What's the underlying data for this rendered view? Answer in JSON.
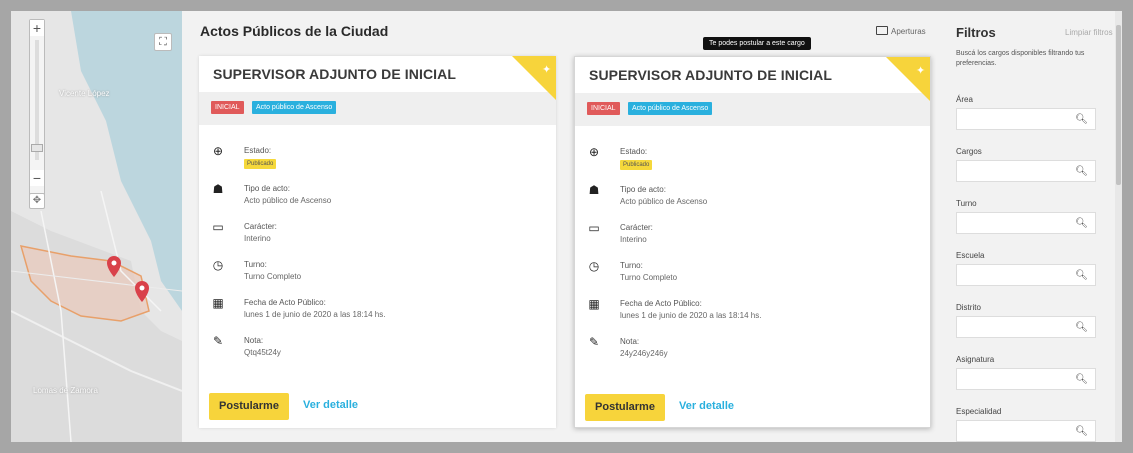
{
  "header": {
    "title": "Actos Públicos de la Ciudad",
    "aperturas": "Aperturas",
    "tooltip": "Te podes postular a este cargo"
  },
  "map": {
    "zoom_in": "+",
    "zoom_out": "−",
    "fullscreen": "⛶",
    "pan": "✥",
    "labels": [
      "Vicente López",
      "Lomas de Zamora"
    ]
  },
  "cards": [
    {
      "title": "SUPERVISOR ADJUNTO DE INICIAL",
      "badge_level": "INICIAL",
      "badge_type": "Acto público de Ascenso",
      "estado_label": "Estado:",
      "estado_value": "Publicado",
      "tipo_label": "Tipo de acto:",
      "tipo_value": "Acto público de Ascenso",
      "caracter_label": "Carácter:",
      "caracter_value": "Interino",
      "turno_label": "Turno:",
      "turno_value": "Turno Completo",
      "fecha_label": "Fecha de Acto Público:",
      "fecha_value": "lunes 1 de junio de 2020 a las 18:14 hs.",
      "nota_label": "Nota:",
      "nota_value": "Qtq45t24y",
      "postular": "Postularme",
      "detalle": "Ver detalle"
    },
    {
      "title": "SUPERVISOR ADJUNTO DE INICIAL",
      "badge_level": "INICIAL",
      "badge_type": "Acto público de Ascenso",
      "estado_label": "Estado:",
      "estado_value": "Publicado",
      "tipo_label": "Tipo de acto:",
      "tipo_value": "Acto público de Ascenso",
      "caracter_label": "Carácter:",
      "caracter_value": "Interino",
      "turno_label": "Turno:",
      "turno_value": "Turno Completo",
      "fecha_label": "Fecha de Acto Público:",
      "fecha_value": "lunes 1 de junio de 2020 a las 18:14 hs.",
      "nota_label": "Nota:",
      "nota_value": "24y246y246y",
      "postular": "Postularme",
      "detalle": "Ver detalle"
    }
  ],
  "filters": {
    "title": "Filtros",
    "clear": "Limpiar filtros",
    "description": "Buscá los cargos disponibles filtrando tus preferencias.",
    "fields": [
      {
        "label": "Área"
      },
      {
        "label": "Cargos"
      },
      {
        "label": "Turno"
      },
      {
        "label": "Escuela"
      },
      {
        "label": "Distrito"
      },
      {
        "label": "Asignatura"
      },
      {
        "label": "Especialidad"
      }
    ]
  },
  "colors": {
    "accent_yellow": "#f7d43b",
    "badge_red": "#e05a5a",
    "badge_blue": "#2ab0de",
    "link_blue": "#2ab0de"
  },
  "icons": {
    "estado": "plus-circle-icon",
    "tipo": "people-icon",
    "caracter": "chat-icon",
    "turno": "clock-icon",
    "fecha": "calendar-icon",
    "nota": "pencil-icon",
    "search": "search-icon"
  }
}
